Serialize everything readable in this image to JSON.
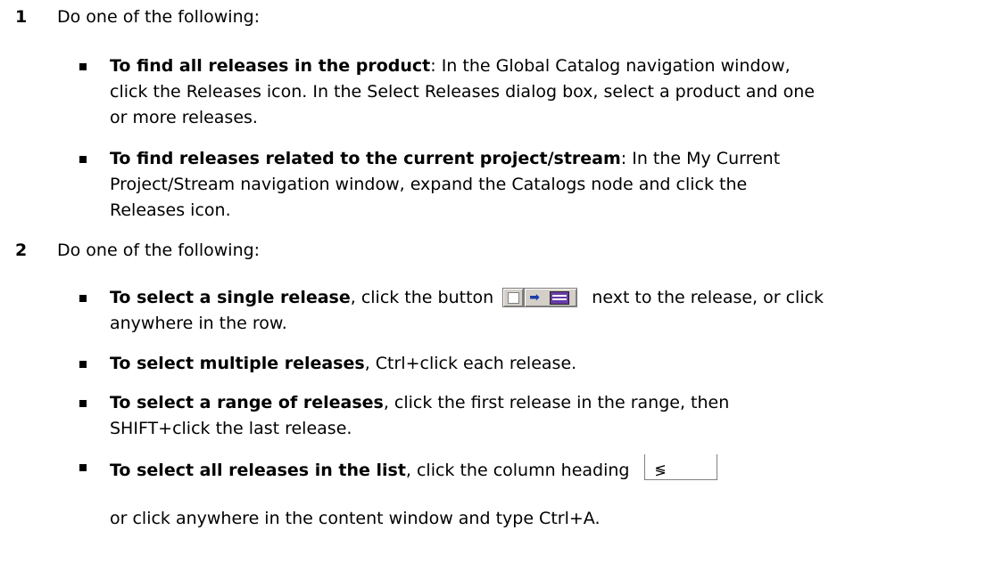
{
  "step1": {
    "number": "1",
    "text": "Do one of the following:",
    "bullets": [
      {
        "lead": "To find all releases in the product",
        "line1": ": In the Global Catalog navigation window,",
        "line2": "click the Releases icon. In the Select Releases dialog box, select a product and one",
        "line3": "or more releases."
      },
      {
        "lead": "To find releases related to the current project/stream",
        "line1": ": In the My Current",
        "line2": "Project/Stream navigation window, expand the Catalogs node and click the",
        "line3": "Releases icon."
      }
    ]
  },
  "step2": {
    "number": "2",
    "text": "Do one of the following:",
    "bullets": [
      {
        "lead": "To select a single release",
        "before_icon": ", click the button",
        "after_icon": "next to the release, or click",
        "line2": "anywhere in the row.",
        "icon": "select-release-button-icon"
      },
      {
        "lead": "To select multiple releases",
        "line1": ", Ctrl+click each release."
      },
      {
        "lead": "To select a range of releases",
        "line1": ", click the first release in the range, then",
        "line2": "SHIFT+click the last release."
      },
      {
        "lead": "To select all releases in the list",
        "line1": ", click the column heading",
        "icon": "select-all-column-heading-icon"
      }
    ],
    "trailing": "or click anywhere in the content window and type Ctrl+A."
  }
}
